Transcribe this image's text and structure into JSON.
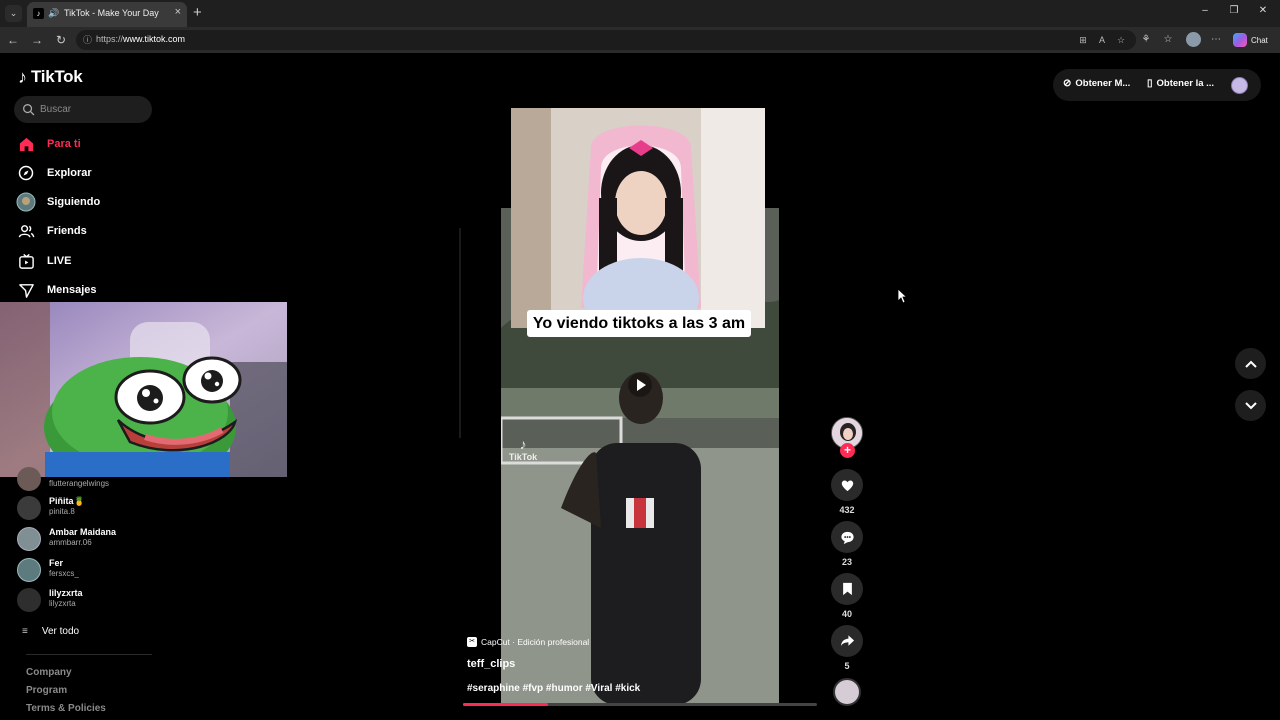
{
  "browser": {
    "tab_title": "TikTok - Make Your Day",
    "url_prefix": "https://",
    "url_host": "www.tiktok.com",
    "chat_label": "Chat"
  },
  "sidebar": {
    "logo_text": "TikTok",
    "search_placeholder": "Buscar",
    "menu": [
      {
        "label": "Para ti",
        "icon": "home-icon",
        "active": true
      },
      {
        "label": "Explorar",
        "icon": "compass-icon"
      },
      {
        "label": "Siguiendo",
        "icon": "following-avatar-icon"
      },
      {
        "label": "Friends",
        "icon": "friends-icon"
      },
      {
        "label": "LIVE",
        "icon": "live-tv-icon"
      },
      {
        "label": "Mensajes",
        "icon": "send-icon"
      }
    ],
    "following": [
      {
        "name": "",
        "handle": "flutterangelwings"
      },
      {
        "name": "Piñita🍍",
        "handle": "pinita.8"
      },
      {
        "name": "Ambar Maidana",
        "handle": "ammbarr.06"
      },
      {
        "name": "Fer",
        "handle": "fersxcs_"
      },
      {
        "name": "lilyzxrta",
        "handle": "lilyzxrta"
      }
    ],
    "see_all": "Ver todo",
    "footer": [
      "Company",
      "Program",
      "Terms & Policies"
    ]
  },
  "header_actions": {
    "get_coins": "Obtener M...",
    "get_app": "Obtener la ..."
  },
  "video": {
    "caption_overlay": "Yo viendo tiktoks a las 3 am",
    "watermark": "TikTok",
    "capcut_label": "CapCut · Edición profesional",
    "author": "teff_clips",
    "hashtags": "#seraphine #fvp #humor #Viral #kick",
    "progress": 0.24
  },
  "actions": {
    "likes": "432",
    "comments": "23",
    "saves": "40",
    "shares": "5"
  },
  "colors": {
    "accent": "#fe2c55",
    "background": "#000000"
  }
}
